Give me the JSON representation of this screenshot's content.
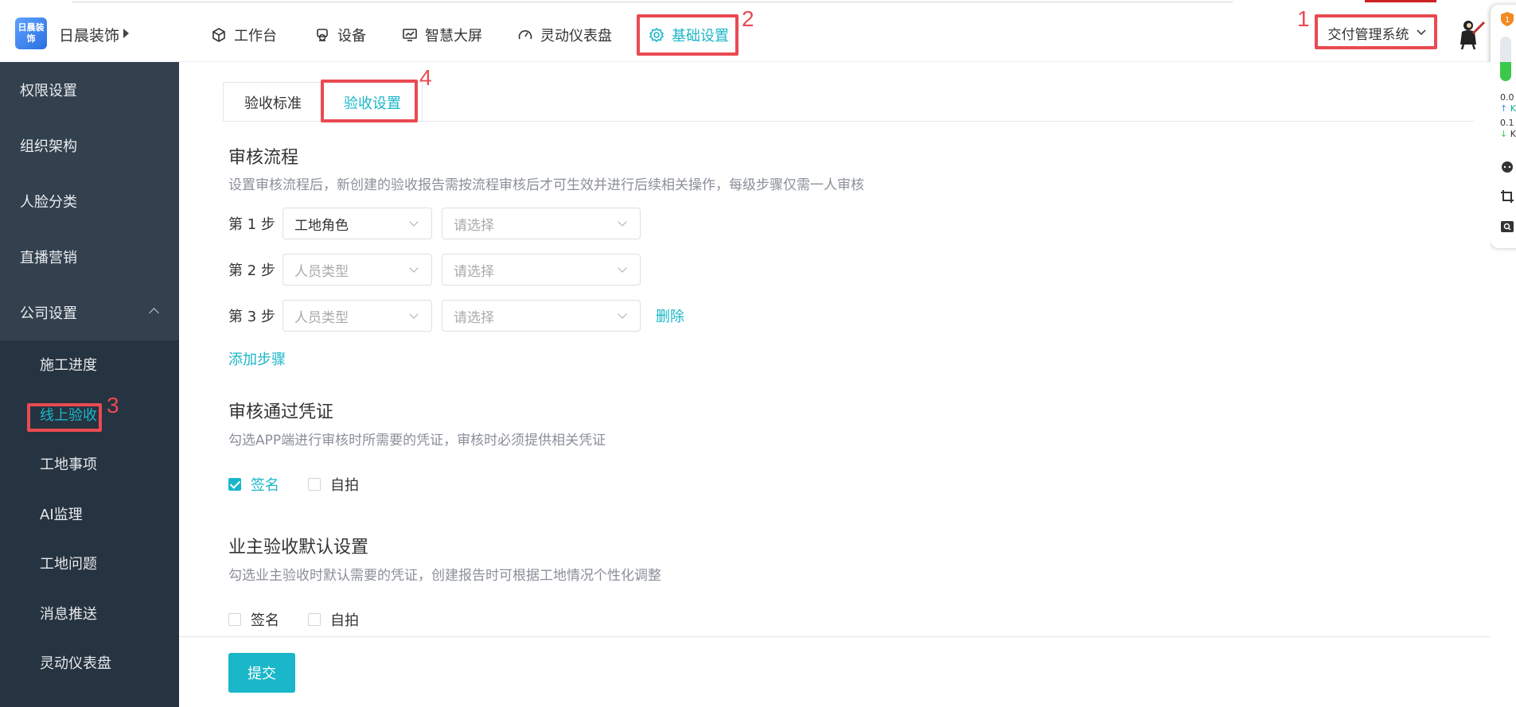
{
  "header": {
    "logo_text": "日晨装饰",
    "company_name": "日晨装饰",
    "nav": [
      {
        "label": "工作台",
        "icon": "cube-icon"
      },
      {
        "label": "设备",
        "icon": "camera-icon"
      },
      {
        "label": "智慧大屏",
        "icon": "monitor-icon"
      },
      {
        "label": "灵动仪表盘",
        "icon": "gauge-icon"
      },
      {
        "label": "基础设置",
        "icon": "gear-icon"
      }
    ],
    "system_select": "交付管理系统",
    "annotations": [
      "1",
      "2",
      "3",
      "4"
    ]
  },
  "widget": {
    "speed_up": "0.0",
    "unit_up": "K/",
    "speed_down": "0.1",
    "unit_down": "K/"
  },
  "sidebar": {
    "items": [
      {
        "label": "权限设置"
      },
      {
        "label": "组织架构"
      },
      {
        "label": "人脸分类"
      },
      {
        "label": "直播营销"
      },
      {
        "label": "公司设置"
      }
    ],
    "sub_items": [
      {
        "label": "施工进度"
      },
      {
        "label": "线上验收"
      },
      {
        "label": "工地事项"
      },
      {
        "label": "AI监理"
      },
      {
        "label": "工地问题"
      },
      {
        "label": "消息推送"
      },
      {
        "label": "灵动仪表盘"
      }
    ]
  },
  "main": {
    "tabs": [
      {
        "label": "验收标准"
      },
      {
        "label": "验收设置"
      }
    ],
    "flow": {
      "title": "审核流程",
      "desc": "设置审核流程后，新创建的验收报告需按流程审核后才可生效并进行后续相关操作，每级步骤仅需一人审核",
      "steps": [
        {
          "label": "第 1 步",
          "type": "工地角色",
          "value_placeholder": "请选择"
        },
        {
          "label": "第 2 步",
          "type": "人员类型",
          "value_placeholder": "请选择"
        },
        {
          "label": "第 3 步",
          "type": "人员类型",
          "value_placeholder": "请选择"
        }
      ],
      "delete_label": "删除",
      "add_step_label": "添加步骤"
    },
    "voucher": {
      "title": "审核通过凭证",
      "desc": "勾选APP端进行审核时所需要的凭证，审核时必须提供相关凭证",
      "options": [
        {
          "label": "签名",
          "checked": true
        },
        {
          "label": "自拍",
          "checked": false
        }
      ]
    },
    "owner": {
      "title": "业主验收默认设置",
      "desc": "勾选业主验收时默认需要的凭证，创建报告时可根据工地情况个性化调整",
      "options": [
        {
          "label": "签名",
          "checked": false
        },
        {
          "label": "自拍",
          "checked": false
        }
      ]
    },
    "submit_label": "提交"
  },
  "colors": {
    "accent": "#1ab6c9",
    "sidebar_bg": "#33404d",
    "sidebar_sub_bg": "#263340",
    "annotation_red": "#e94a52"
  }
}
